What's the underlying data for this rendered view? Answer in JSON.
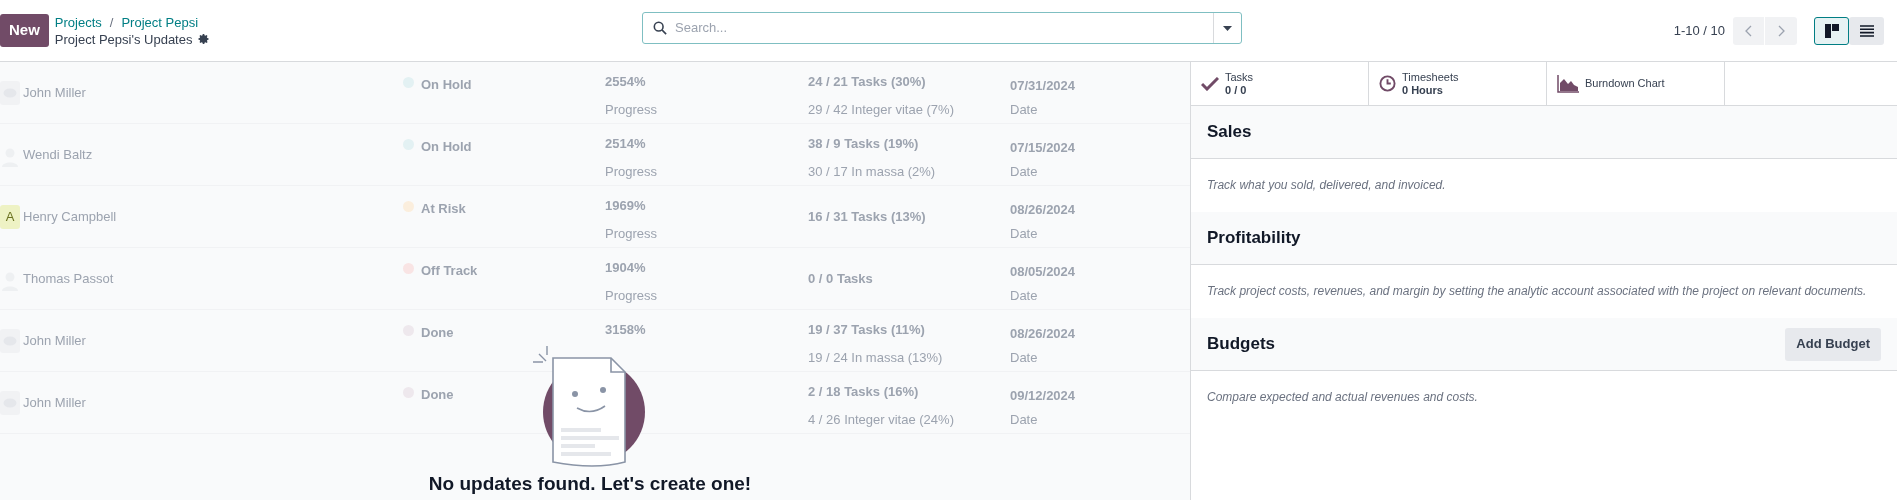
{
  "header": {
    "new_button": "New",
    "breadcrumbs": [
      "Projects",
      "Project Pepsi"
    ],
    "breadcrumb_separator": "/",
    "title": "Project Pepsi's Updates",
    "search": {
      "placeholder": "Search..."
    },
    "pager": "1-10 / 10",
    "views": [
      {
        "kind": "kanban",
        "selected": true
      },
      {
        "kind": "list",
        "selected": false
      }
    ]
  },
  "updates": [
    {
      "kind": "bot",
      "name": "John Miller",
      "status": "On Hold",
      "color": "#e3f1f3",
      "progress": "2554%",
      "progress_label": "Progress",
      "tasks": "24 / 21 Tasks (30%)",
      "milestones": "29 / 42 Integer vitae (7%)",
      "date": "07/31/2024",
      "date_label": "Date"
    },
    {
      "kind": "person",
      "name": "Wendi Baltz",
      "status": "On Hold",
      "color": "#e3f1f3",
      "progress": "2514%",
      "progress_label": "Progress",
      "tasks": "38 / 9 Tasks (19%)",
      "milestones": "30 / 17 In massa (2%)",
      "date": "07/15/2024",
      "date_label": "Date"
    },
    {
      "kind": "letter",
      "avatar_letter": "A",
      "name": "Henry Campbell",
      "status": "At Risk",
      "color": "#fbeedd",
      "progress": "1969%",
      "progress_label": "Progress",
      "tasks": "16 / 31 Tasks (13%)",
      "date": "08/26/2024",
      "date_label": "Date"
    },
    {
      "kind": "person",
      "name": "Thomas Passot",
      "status": "Off Track",
      "color": "#f9e4e4",
      "progress": "1904%",
      "progress_label": "Progress",
      "tasks": "0 / 0 Tasks",
      "date": "08/05/2024",
      "date_label": "Date"
    },
    {
      "kind": "bot",
      "name": "John Miller",
      "status": "Done",
      "color": "#eee8ed",
      "progress": "3158%",
      "tasks": "19 / 37 Tasks (11%)",
      "milestones": "19 / 24 In massa (13%)",
      "date": "08/26/2024",
      "date_label": "Date"
    },
    {
      "kind": "bot",
      "name": "John Miller",
      "status": "Done",
      "color": "#eee8ed",
      "tasks": "2 / 18 Tasks (16%)",
      "milestones": "4 / 26 Integer vitae (24%)",
      "date": "09/12/2024",
      "date_label": "Date"
    }
  ],
  "empty_state": "No updates found. Let's create one!",
  "stat_buttons": [
    {
      "kind": "tasks",
      "label": "Tasks",
      "value": "0 / 0"
    },
    {
      "kind": "timesheets",
      "label": "Timesheets",
      "value": "0 Hours"
    },
    {
      "kind": "burndown",
      "label": "Burndown Chart"
    }
  ],
  "sections": [
    {
      "title": "Sales",
      "description": "Track what you sold, delivered, and invoiced."
    },
    {
      "title": "Profitability",
      "description": "Track project costs, revenues, and margin by setting the analytic account associated with the project on relevant documents."
    },
    {
      "title": "Budgets",
      "button": "Add Budget",
      "description": "Compare expected and actual revenues and costs."
    }
  ]
}
